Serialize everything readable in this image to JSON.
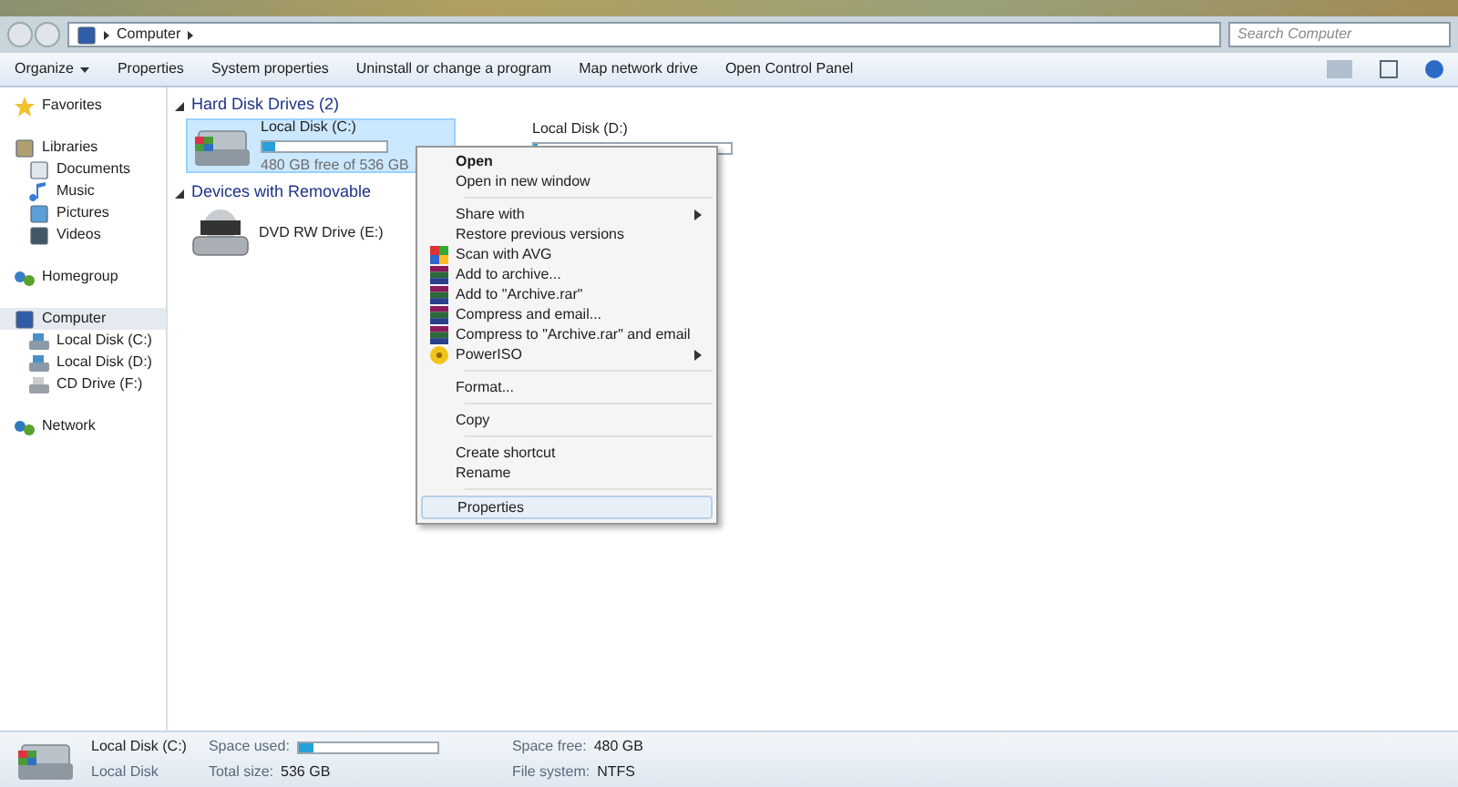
{
  "address_bar": {
    "path": [
      "Computer"
    ],
    "search_placeholder": "Search Computer"
  },
  "toolbar": {
    "organize": "Organize",
    "buttons": [
      "Properties",
      "System properties",
      "Uninstall or change a program",
      "Map network drive",
      "Open Control Panel"
    ]
  },
  "sidebar": {
    "groups": [
      {
        "label": "Favorites",
        "selected": false
      },
      {
        "label": "Libraries",
        "selected": false,
        "children": [
          {
            "label": "Documents",
            "selected": false
          },
          {
            "label": "Music",
            "selected": false
          },
          {
            "label": "Pictures",
            "selected": false
          },
          {
            "label": "Videos",
            "selected": false
          }
        ]
      },
      {
        "label": "Homegroup",
        "selected": false
      },
      {
        "label": "Computer",
        "selected": true,
        "children": [
          {
            "label": "Local Disk (C:)",
            "selected": false
          },
          {
            "label": "Local Disk (D:)",
            "selected": false
          },
          {
            "label": "CD Drive (F:)",
            "selected": false
          }
        ]
      },
      {
        "label": "Network",
        "selected": false
      }
    ]
  },
  "sections": [
    {
      "title": "Hard Disk Drives (2)",
      "items": [
        {
          "kind": "disk",
          "name": "Local Disk (C:)",
          "level": 0.1,
          "free": "480 GB free of 536 GB",
          "selected": true
        },
        {
          "kind": "disk",
          "name": "Local Disk (D:)",
          "level": 0.02,
          "selected": false
        }
      ]
    },
    {
      "title": "Devices with Removable",
      "items": [
        {
          "kind": "dvd",
          "name": "DVD RW Drive (E:)",
          "selected": false
        }
      ]
    }
  ],
  "context_menu": [
    {
      "kind": "item",
      "label": "Open",
      "bold": true,
      "submenu": false,
      "selected": false
    },
    {
      "kind": "item",
      "label": "Open in new window",
      "bold": false,
      "submenu": false,
      "selected": false
    },
    {
      "kind": "separator"
    },
    {
      "kind": "item",
      "label": "Share with",
      "bold": false,
      "submenu": true,
      "selected": false
    },
    {
      "kind": "item",
      "label": "Restore previous versions",
      "bold": false,
      "submenu": false,
      "selected": false
    },
    {
      "kind": "avg",
      "label": "Scan with AVG",
      "bold": false,
      "submenu": false,
      "selected": false
    },
    {
      "kind": "archive",
      "label": "Add to archive...",
      "bold": false,
      "submenu": false,
      "selected": false
    },
    {
      "kind": "archive",
      "label": "Add to \"Archive.rar\"",
      "bold": false,
      "submenu": false,
      "selected": false
    },
    {
      "kind": "archive",
      "label": "Compress and email...",
      "bold": false,
      "submenu": false,
      "selected": false
    },
    {
      "kind": "archive",
      "label": "Compress to \"Archive.rar\" and email",
      "bold": false,
      "submenu": false,
      "selected": false
    },
    {
      "kind": "disc",
      "label": "PowerISO",
      "bold": false,
      "submenu": true,
      "selected": false
    },
    {
      "kind": "separator"
    },
    {
      "kind": "item",
      "label": "Format...",
      "bold": false,
      "submenu": false,
      "selected": false
    },
    {
      "kind": "separator"
    },
    {
      "kind": "item",
      "label": "Copy",
      "bold": false,
      "submenu": false,
      "selected": false
    },
    {
      "kind": "separator"
    },
    {
      "kind": "item",
      "label": "Create shortcut",
      "bold": false,
      "submenu": false,
      "selected": false
    },
    {
      "kind": "item",
      "label": "Rename",
      "bold": false,
      "submenu": false,
      "selected": false
    },
    {
      "kind": "separator"
    },
    {
      "kind": "item",
      "label": "Properties",
      "bold": false,
      "submenu": false,
      "selected": true
    }
  ],
  "details": {
    "name": "Local Disk (C:)",
    "type": "Local Disk",
    "fields": [
      {
        "label": "Space used:",
        "kind": "bar",
        "level": 0.1
      },
      {
        "label": "Total size:",
        "kind": "text",
        "value": "536 GB"
      },
      {
        "label": "Space free:",
        "kind": "text",
        "value": "480 GB"
      },
      {
        "label": "File system:",
        "kind": "text",
        "value": "NTFS"
      }
    ]
  }
}
